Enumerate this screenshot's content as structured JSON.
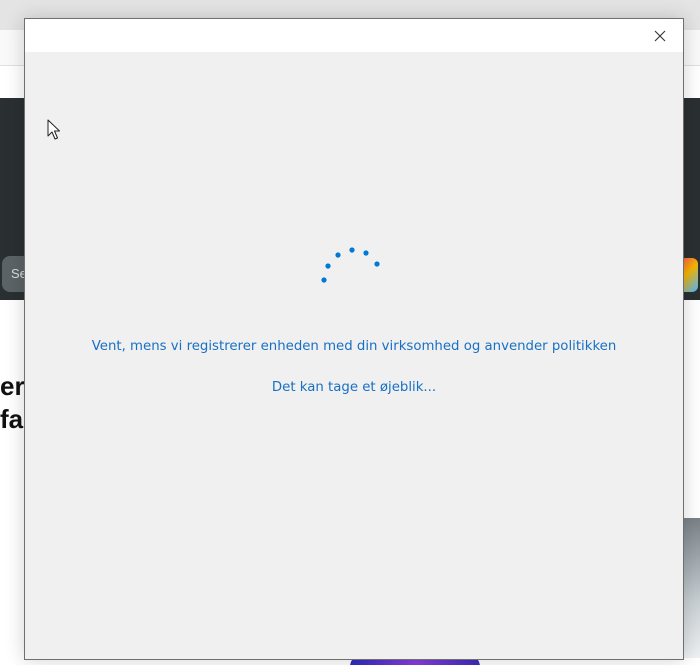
{
  "dialog": {
    "message": "Vent, mens vi registrerer enheden med din virksomhed og anvender politikken",
    "submessage": "Det kan tage et øjeblik..."
  },
  "background": {
    "hero_pill_text": "Se",
    "heading_text": "er\nfa"
  },
  "icons": {
    "close": "close-icon",
    "spinner": "loading-spinner-icon",
    "cursor": "mouse-pointer-icon"
  },
  "colors": {
    "accent": "#1870c4",
    "dialog_background": "#f0f0f0",
    "spinner_dots": "#0078d4"
  }
}
